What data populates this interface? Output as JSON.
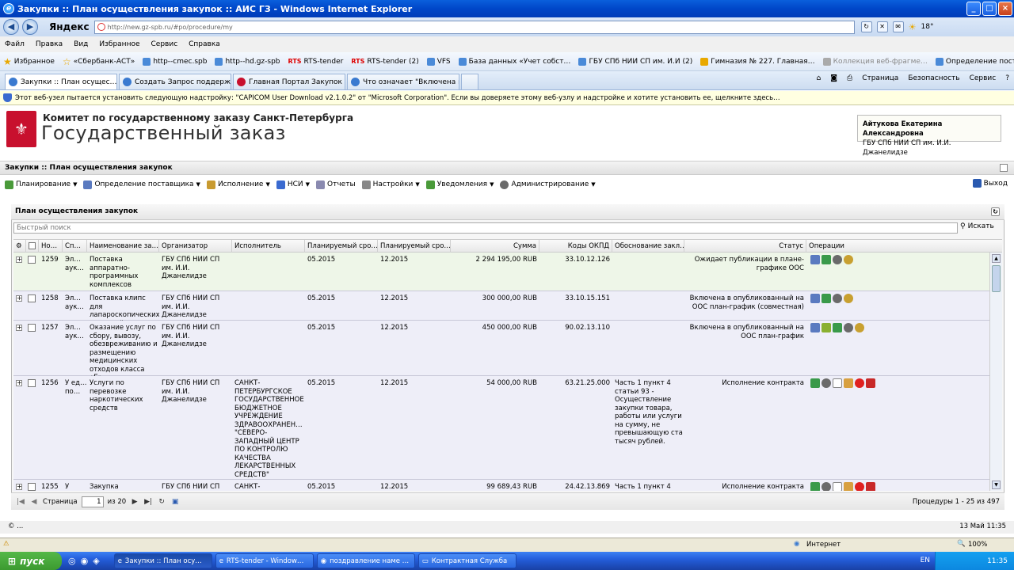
{
  "window": {
    "title": "Закупки :: План осуществления закупок :: АИС ГЗ - Windows Internet Explorer"
  },
  "address": {
    "brand": "Яндекс",
    "url": "http://new.gz-spb.ru/#po/procedure/my",
    "weather": "18°"
  },
  "menu": [
    "Файл",
    "Правка",
    "Вид",
    "Избранное",
    "Сервис",
    "Справка"
  ],
  "favorites": {
    "label": "Избранное",
    "items": [
      "«Сбербанк-АСТ»",
      "http--cmec.spb",
      "http--hd.gz-spb",
      "RTS-tender",
      "RTS-tender (2)",
      "VFS",
      "База данных «Учет собст…",
      "ГБУ СПб НИИ СП им. И.И (2)",
      "Гимназия № 227. Главная…",
      "Коллекция веб-фрагме…",
      "Определение поставщика"
    ],
    "rts_label": "RTS"
  },
  "tabs": [
    {
      "label": "Закупки :: План осущес…"
    },
    {
      "label": "Создать Запрос поддержк…"
    },
    {
      "label": "Главная Портал Закупок"
    },
    {
      "label": "Что означает \"Включена в …"
    }
  ],
  "commands": {
    "page": "Страница",
    "security": "Безопасность",
    "service": "Сервис"
  },
  "infobar": "Этот веб-узел пытается установить следующую надстройку: \"CAPICOM User Download v2.1.0.2\" от \"Microsoft Corporation\". Если вы доверяете этому веб-узлу и надстройке и хотите установить ее, щелкните здесь…",
  "site": {
    "org": "Комитет по государственному заказу Санкт-Петербурга",
    "title": "Государственный заказ",
    "user_name": "Айтукова Екатерина Александровна",
    "user_org": "ГБУ СПб НИИ СП им. И.И. Джанелидзе"
  },
  "breadcrumb": "Закупки :: План осуществления закупок",
  "toolbar": {
    "items": [
      "Планирование",
      "Определение поставщика",
      "Исполнение",
      "НСИ",
      "Отчеты",
      "Настройки",
      "Уведомления",
      "Администрирование"
    ],
    "logout": "Выход"
  },
  "panel": {
    "title": "План осуществления закупок",
    "search_placeholder": "Быстрый поиск",
    "search_button": "Искать"
  },
  "columns": [
    "Но…",
    "Сп…",
    "Наименование за…",
    "Организатор",
    "Исполнитель",
    "Планируемый сро…",
    "Планируемый сро…",
    "Сумма",
    "Коды ОКПД",
    "Обоснование закл…",
    "Статус",
    "Операции"
  ],
  "rows": [
    {
      "num": "1259",
      "method": "Эл… аук…",
      "name": "Поставка аппаратно-программных комплексов",
      "organizer": "ГБУ СПб НИИ СП им. И.И. Джанелидзе",
      "executor": "",
      "start": "05.2015",
      "end": "12.2015",
      "sum": "2 294 195,00 RUB",
      "okpd": "33.10.12.126",
      "basis": "",
      "status": "Ожидает публикации в плане-графике ООС"
    },
    {
      "num": "1258",
      "method": "Эл… аук…",
      "name": "Поставка клипс для лапароскопических операций",
      "organizer": "ГБУ СПб НИИ СП им. И.И. Джанелидзе",
      "executor": "",
      "start": "05.2015",
      "end": "12.2015",
      "sum": "300 000,00 RUB",
      "okpd": "33.10.15.151",
      "basis": "",
      "status": "Включена в опубликованный на ООС план-график (совместная)"
    },
    {
      "num": "1257",
      "method": "Эл… аук…",
      "name": "Оказание услуг по сбору, вывозу, обезвреживанию и размещению медицинских отходов класса «Б»",
      "organizer": "ГБУ СПб НИИ СП им. И.И. Джанелидзе",
      "executor": "",
      "start": "05.2015",
      "end": "12.2015",
      "sum": "450 000,00 RUB",
      "okpd": "90.02.13.110",
      "basis": "",
      "status": "Включена в опубликованный на ООС план-график"
    },
    {
      "num": "1256",
      "method": "У ед… по…",
      "name": "Услуги по перевозке наркотических средств",
      "organizer": "ГБУ СПб НИИ СП им. И.И. Джанелидзе",
      "executor": "САНКТ-ПЕТЕРБУРГСКОЕ ГОСУДАРСТВЕННОЕ БЮДЖЕТНОЕ УЧРЕЖДЕНИЕ ЗДРАВООХРАНЕН… \"СЕВЕРО-ЗАПАДНЫЙ ЦЕНТР ПО КОНТРОЛЮ КАЧЕСТВА ЛЕКАРСТВЕННЫХ СРЕДСТВ\"",
      "start": "05.2015",
      "end": "12.2015",
      "sum": "54 000,00 RUB",
      "okpd": "63.21.25.000",
      "basis": "Часть 1 пункт 4 статьи 93 - Осуществление закупки товара, работы или услуги на сумму, не превышающую ста тысяч рублей.",
      "status": "Исполнение контракта"
    },
    {
      "num": "1255",
      "method": "У",
      "name": "Закупка",
      "organizer": "ГБУ СПб НИИ СП",
      "executor": "САНКТ-",
      "start": "05.2015",
      "end": "12.2015",
      "sum": "99 689,43 RUB",
      "okpd": "24.42.13.869",
      "basis": "Часть 1 пункт 4",
      "status": "Исполнение контракта"
    }
  ],
  "pager": {
    "label": "Страница",
    "page": "1",
    "of": "из 20",
    "info": "Процедуры 1 - 25 из 497"
  },
  "footer": {
    "left": "© ...",
    "date": "13 Май 11:35"
  },
  "iestatus": {
    "zone": "Интернет",
    "zoom": "100%"
  },
  "taskbar": {
    "start": "пуск",
    "tasks": [
      "Закупки :: План осу…",
      "RTS-tender - Window…",
      "поздравление наме …",
      "Контрактная Служба"
    ],
    "lang": "EN",
    "time": "11:35"
  },
  "colors": {
    "row_highlight": "#eef6e8",
    "row_alt": "#eeeef8",
    "accent": "#0046c8"
  }
}
